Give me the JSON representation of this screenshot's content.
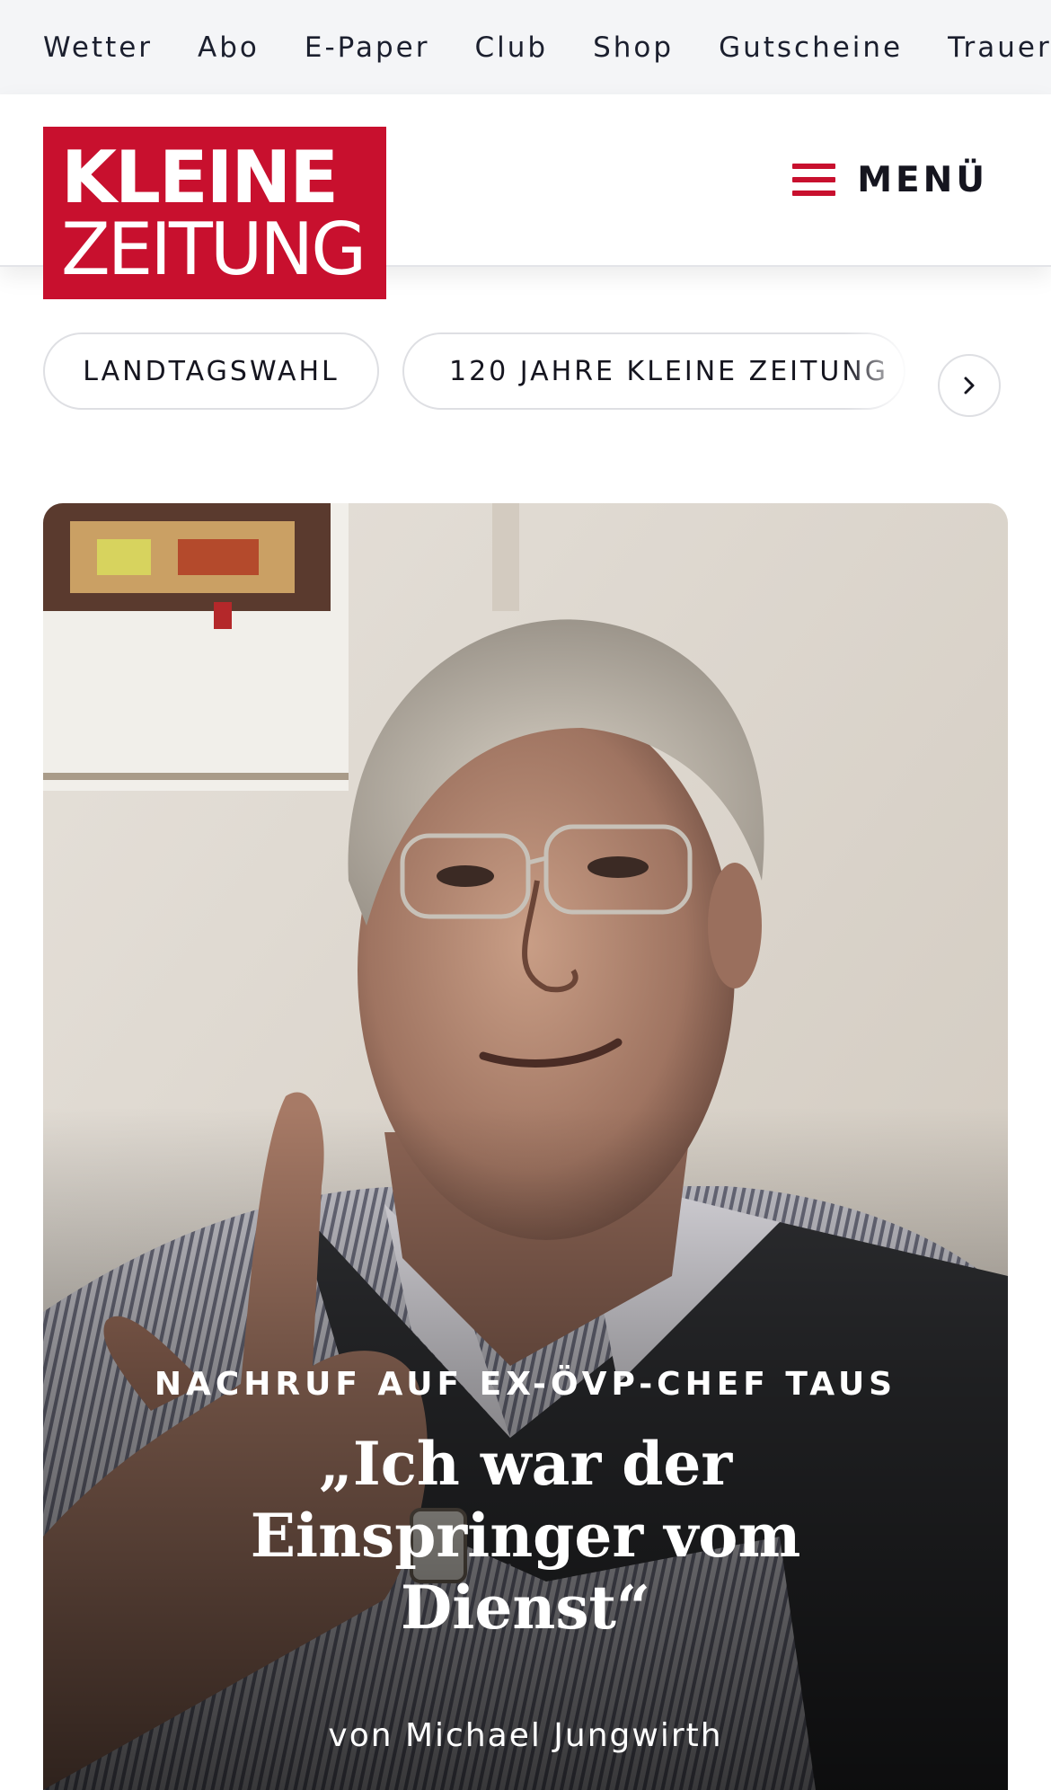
{
  "topbar": {
    "links": [
      "Wetter",
      "Abo",
      "E-Paper",
      "Club",
      "Shop",
      "Gutscheine",
      "Trauerportal"
    ]
  },
  "header": {
    "logo_line1": "KLEINE",
    "logo_line2": "ZEITUNG",
    "menu_label": "MENÜ"
  },
  "chips": {
    "items": [
      "LANDTAGSWAHL",
      "120 JAHRE KLEINE ZEITUNG"
    ]
  },
  "hero": {
    "kicker": "NACHRUF AUF EX-ÖVP-CHEF TAUS",
    "title": "„Ich war der Einspringer vom Dienst“",
    "author": "von Michael Jungwirth"
  },
  "colors": {
    "brand_red": "#c8102e",
    "topbar_bg": "#f4f5f7",
    "text_dark": "#15151f"
  },
  "icons": {
    "menu": "hamburger-icon",
    "chips_next": "chevron-right-icon"
  }
}
